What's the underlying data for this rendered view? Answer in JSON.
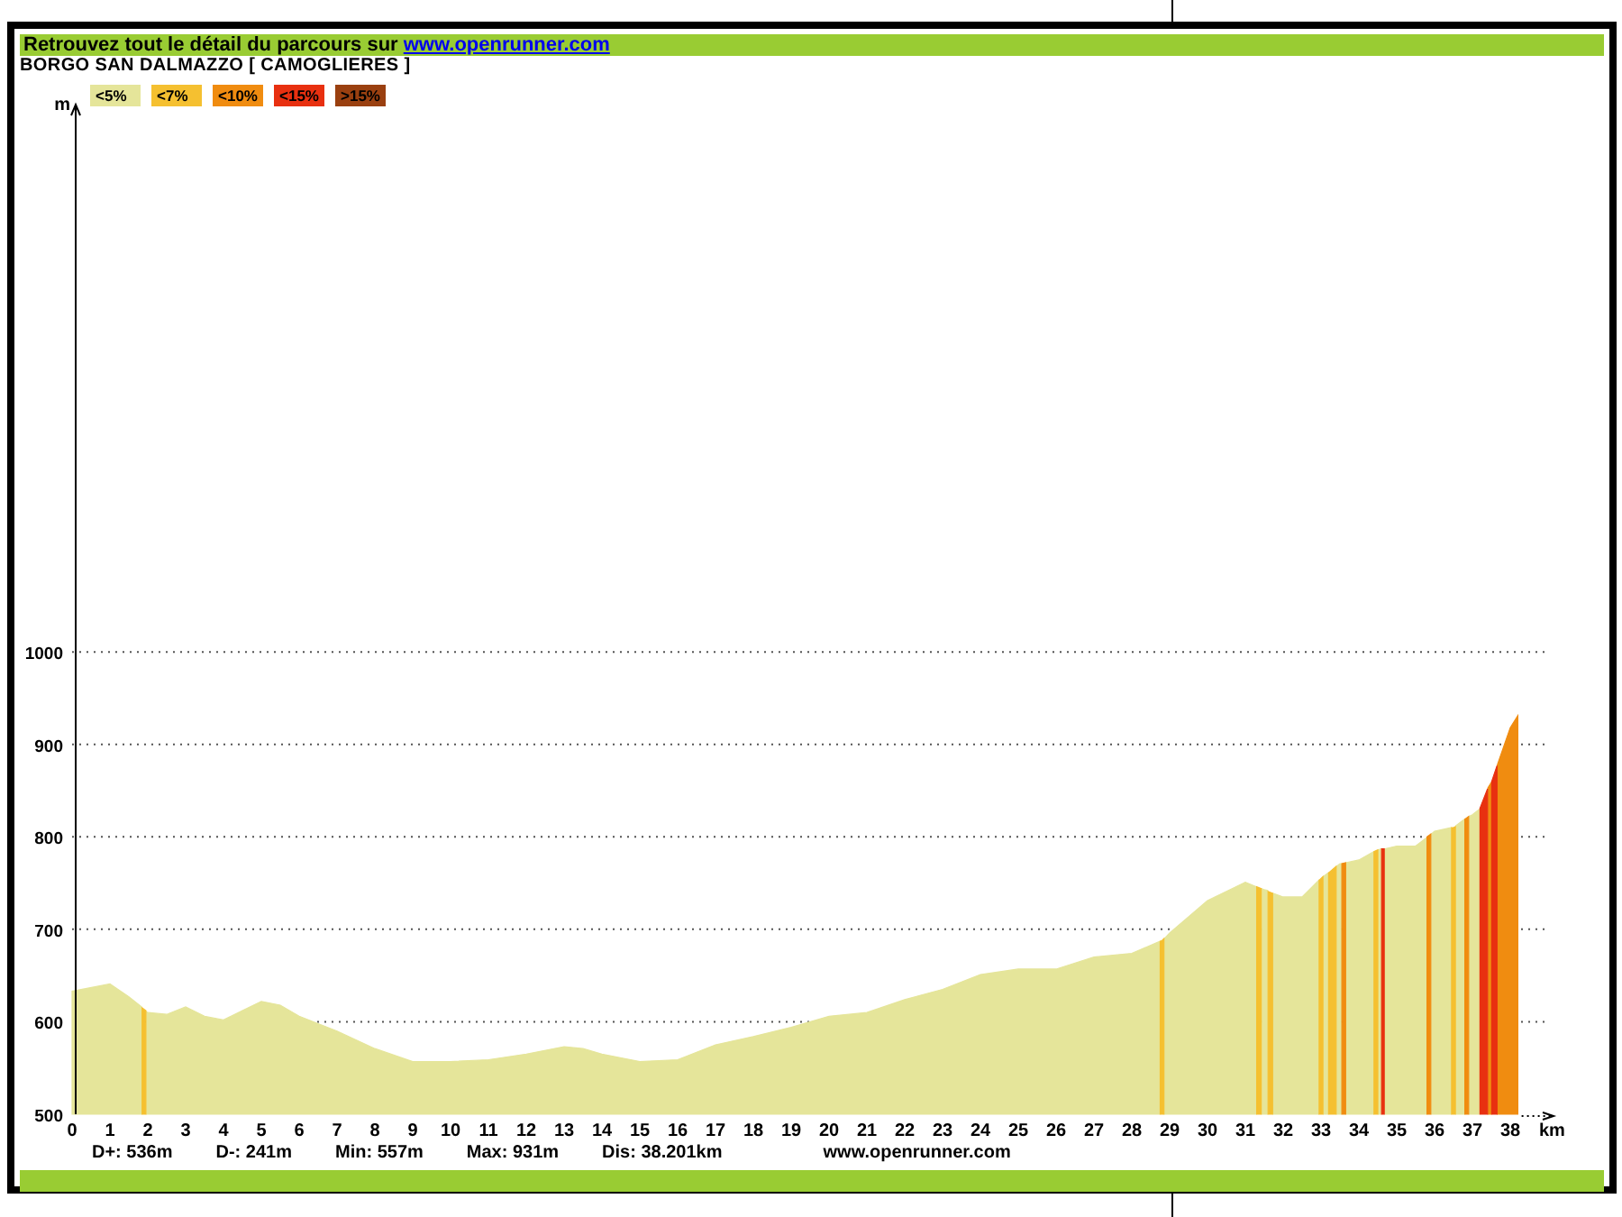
{
  "header": {
    "text": "Retrouvez tout le détail du parcours sur ",
    "link": "www.openrunner.com"
  },
  "title": "BORGO SAN DALMAZZO [ CAMOGLIERES ]",
  "legend": [
    {
      "label": "<5%",
      "color": "#e5e59a"
    },
    {
      "label": "<7%",
      "color": "#f5c030"
    },
    {
      "label": "<10%",
      "color": "#f08c10"
    },
    {
      "label": "<15%",
      "color": "#e83010"
    },
    {
      "label": ">15%",
      "color": "#9a4010"
    }
  ],
  "chart_data": {
    "type": "area",
    "xlabel": "km",
    "ylabel": "m",
    "grid": true,
    "x": [
      0,
      1,
      1.5,
      1.84,
      1.85,
      1.95,
      1.96,
      2,
      2.5,
      3,
      3.5,
      4,
      4.5,
      5,
      5.5,
      6,
      7,
      8,
      9,
      10,
      11,
      12,
      13,
      13.5,
      14,
      15,
      16,
      17,
      18,
      19,
      20,
      21,
      22,
      23,
      24,
      25,
      26,
      27,
      28,
      28.74,
      28.75,
      28.8,
      28.85,
      28.86,
      29,
      30,
      31,
      31.29,
      31.3,
      31.42,
      31.43,
      31.5,
      31.59,
      31.6,
      31.72,
      31.73,
      32,
      32.5,
      32.94,
      32.95,
      33,
      33.05,
      33.06,
      33.19,
      33.2,
      33.4,
      33.41,
      33.5,
      33.54,
      33.55,
      33.65,
      33.66,
      34,
      34.39,
      34.4,
      34.5,
      34.51,
      34.59,
      34.6,
      34.67,
      34.68,
      35,
      35.5,
      35.79,
      35.8,
      35.9,
      35.91,
      36,
      36.44,
      36.45,
      36.5,
      36.55,
      36.56,
      36.79,
      36.8,
      36.9,
      36.91,
      37,
      37.19,
      37.2,
      37.4,
      37.41,
      37.5,
      37.51,
      37.65,
      37.66,
      38,
      38.2
    ],
    "series": [
      {
        "color": "#e5e59a",
        "values": [
          633,
          641,
          627,
          616,
          null,
          null,
          611,
          610,
          608,
          616,
          606,
          602,
          612,
          622,
          618,
          606,
          590,
          571,
          557,
          557,
          559,
          565,
          573,
          571,
          565,
          557,
          559,
          575,
          584,
          594,
          606,
          610,
          624,
          635,
          651,
          657,
          657,
          670,
          674,
          687,
          null,
          null,
          null,
          690,
          696,
          731,
          751,
          746,
          null,
          null,
          744,
          743,
          742,
          null,
          null,
          739,
          735,
          735,
          753,
          null,
          null,
          null,
          757,
          761,
          null,
          null,
          768,
          771,
          771,
          null,
          null,
          772,
          775,
          784,
          null,
          null,
          786,
          787,
          null,
          null,
          787,
          790,
          790,
          799,
          null,
          null,
          803,
          806,
          810,
          null,
          null,
          null,
          812,
          819,
          null,
          null,
          822,
          824,
          830,
          null,
          null,
          null,
          null,
          null,
          null,
          null,
          null,
          null
        ]
      },
      {
        "color": "#f5c030",
        "values": [
          null,
          null,
          null,
          null,
          615,
          612,
          null,
          null,
          null,
          null,
          null,
          null,
          null,
          null,
          null,
          null,
          null,
          null,
          null,
          null,
          null,
          null,
          null,
          null,
          null,
          null,
          null,
          null,
          null,
          null,
          null,
          null,
          null,
          null,
          null,
          null,
          null,
          null,
          null,
          null,
          687,
          688,
          690,
          null,
          null,
          null,
          null,
          null,
          746,
          744,
          null,
          null,
          null,
          741,
          739,
          null,
          null,
          null,
          null,
          753,
          755,
          757,
          null,
          null,
          761,
          768,
          null,
          null,
          null,
          null,
          null,
          null,
          null,
          null,
          784,
          786,
          null,
          null,
          null,
          null,
          null,
          null,
          null,
          null,
          null,
          null,
          null,
          null,
          null,
          810,
          810,
          811,
          null,
          null,
          null,
          null,
          null,
          null,
          null,
          null,
          null,
          null,
          null,
          null,
          null,
          null,
          null,
          null
        ]
      },
      {
        "color": "#f08c10",
        "values": [
          null,
          null,
          null,
          null,
          null,
          null,
          null,
          null,
          null,
          null,
          null,
          null,
          null,
          null,
          null,
          null,
          null,
          null,
          null,
          null,
          null,
          null,
          null,
          null,
          null,
          null,
          null,
          null,
          null,
          null,
          null,
          null,
          null,
          null,
          null,
          null,
          null,
          null,
          null,
          null,
          null,
          null,
          null,
          null,
          null,
          null,
          null,
          null,
          null,
          null,
          null,
          null,
          null,
          null,
          null,
          null,
          null,
          null,
          null,
          null,
          null,
          null,
          null,
          null,
          null,
          null,
          null,
          null,
          null,
          771,
          772,
          null,
          null,
          null,
          null,
          null,
          null,
          null,
          null,
          null,
          null,
          null,
          null,
          null,
          800,
          803,
          null,
          null,
          null,
          null,
          null,
          null,
          null,
          null,
          819,
          822,
          null,
          null,
          null,
          null,
          null,
          853,
          859,
          null,
          null,
          878,
          918,
          931
        ]
      },
      {
        "color": "#e83010",
        "values": [
          null,
          null,
          null,
          null,
          null,
          null,
          null,
          null,
          null,
          null,
          null,
          null,
          null,
          null,
          null,
          null,
          null,
          null,
          null,
          null,
          null,
          null,
          null,
          null,
          null,
          null,
          null,
          null,
          null,
          null,
          null,
          null,
          null,
          null,
          null,
          null,
          null,
          null,
          null,
          null,
          null,
          null,
          null,
          null,
          null,
          null,
          null,
          null,
          null,
          null,
          null,
          null,
          null,
          null,
          null,
          null,
          null,
          null,
          null,
          null,
          null,
          null,
          null,
          null,
          null,
          null,
          null,
          null,
          null,
          null,
          null,
          null,
          null,
          null,
          null,
          null,
          null,
          null,
          787,
          787,
          null,
          null,
          null,
          null,
          null,
          null,
          null,
          null,
          null,
          null,
          null,
          null,
          null,
          null,
          null,
          null,
          null,
          null,
          null,
          831,
          852,
          null,
          null,
          860,
          877,
          null,
          null,
          null
        ]
      }
    ],
    "xlim": [
      0,
      39
    ],
    "ylim": [
      500,
      1590
    ],
    "xticks": [
      0,
      1,
      2,
      3,
      4,
      5,
      6,
      7,
      8,
      9,
      10,
      11,
      12,
      13,
      14,
      15,
      16,
      17,
      18,
      19,
      20,
      21,
      22,
      23,
      24,
      25,
      26,
      27,
      28,
      29,
      30,
      31,
      32,
      33,
      34,
      35,
      36,
      37,
      38
    ],
    "yticks": [
      500,
      600,
      700,
      800,
      900,
      1000
    ]
  },
  "stats": [
    "D+: 536m",
    "D-: 241m",
    "Min: 557m",
    "Max: 931m",
    "Dis: 38.201km"
  ],
  "footer_link": "www.openrunner.com"
}
